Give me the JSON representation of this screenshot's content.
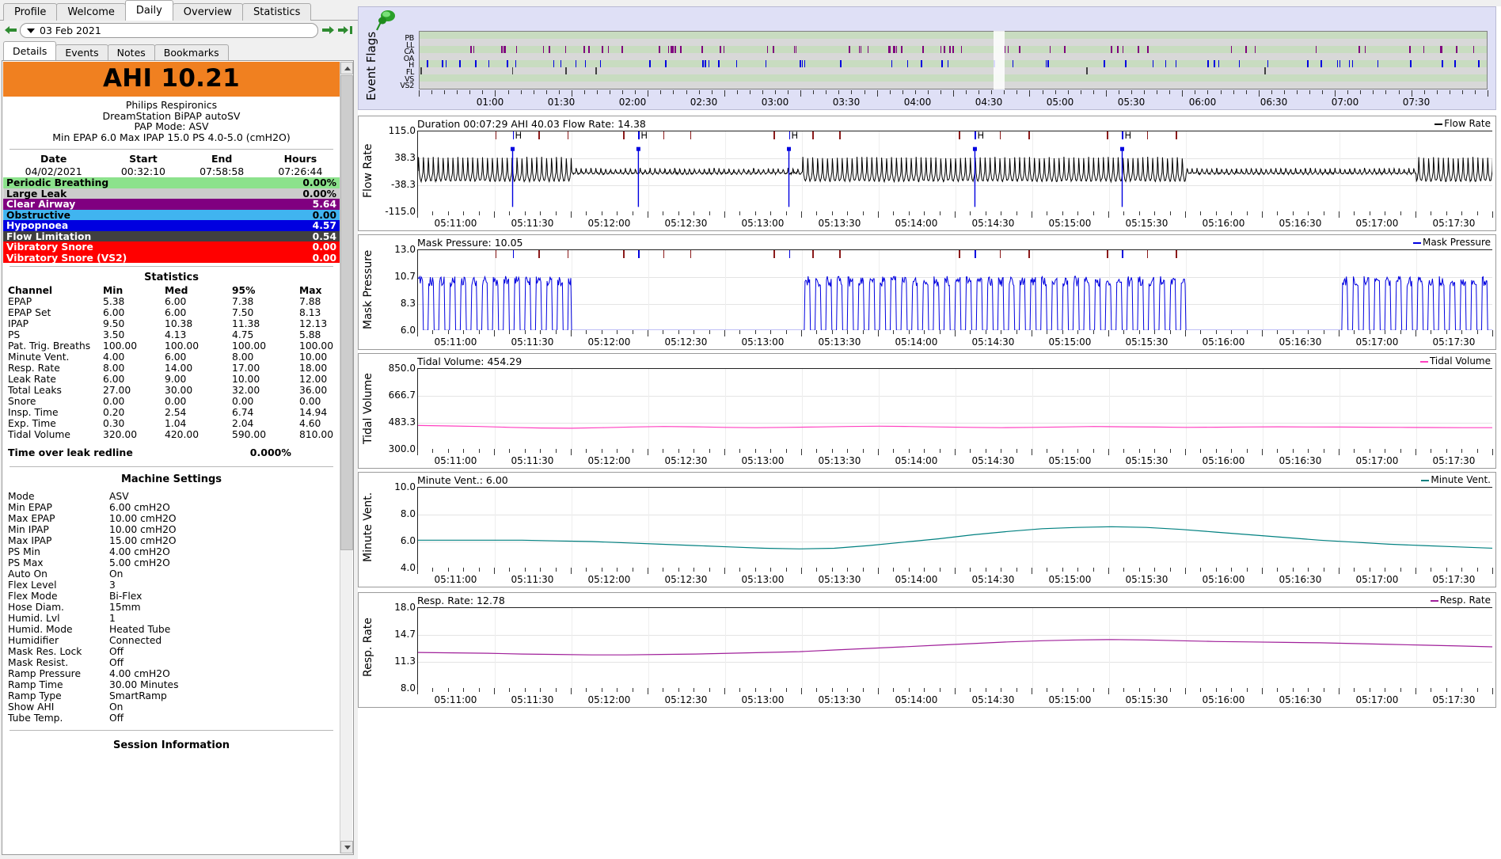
{
  "window": {
    "main_tabs": [
      {
        "label": "Profile",
        "active": false
      },
      {
        "label": "Welcome",
        "active": false
      },
      {
        "label": "Daily",
        "active": true
      },
      {
        "label": "Overview",
        "active": false
      },
      {
        "label": "Statistics",
        "active": false
      }
    ],
    "date_selector": {
      "value": "03 Feb 2021"
    },
    "sub_tabs": [
      {
        "label": "Details",
        "active": true
      },
      {
        "label": "Events",
        "active": false
      },
      {
        "label": "Notes",
        "active": false
      },
      {
        "label": "Bookmarks",
        "active": false
      }
    ]
  },
  "details": {
    "ahi_banner": "AHI 10.21",
    "ahi_banner_color": "#f08020",
    "manufacturer": "Philips Respironics",
    "model": "DreamStation BiPAP autoSV",
    "pap_mode": "PAP Mode: ASV",
    "pressure_summary": "Min EPAP 6.0 Max IPAP 15.0 PS 4.0-5.0 (cmH2O)",
    "session_headers": [
      "Date",
      "Start",
      "End",
      "Hours"
    ],
    "session_values": [
      "04/02/2021",
      "00:32:10",
      "07:58:58",
      "07:26:44"
    ],
    "event_rows": [
      {
        "label": "Periodic Breathing",
        "value": "0.00%",
        "bg": "#8ce28c",
        "fg": "#000000"
      },
      {
        "label": "Large Leak",
        "value": "0.00%",
        "bg": "#cccccc",
        "fg": "#000000"
      },
      {
        "label": "Clear Airway",
        "value": "5.64",
        "bg": "#800080",
        "fg": "#ffffff"
      },
      {
        "label": "Obstructive",
        "value": "0.00",
        "bg": "#40b4f0",
        "fg": "#000000"
      },
      {
        "label": "Hypopnoea",
        "value": "4.57",
        "bg": "#0000e0",
        "fg": "#ffffff"
      },
      {
        "label": "Flow Limitation",
        "value": "0.54",
        "bg": "#404040",
        "fg": "#ffffff"
      },
      {
        "label": "Vibratory Snore",
        "value": "0.00",
        "bg": "#ff0000",
        "fg": "#ffffff"
      },
      {
        "label": "Vibratory Snore (VS2)",
        "value": "0.00",
        "bg": "#ff0000",
        "fg": "#ffffff"
      }
    ],
    "statistics_title": "Statistics",
    "statistics_headers": [
      "Channel",
      "Min",
      "Med",
      "95%",
      "Max"
    ],
    "statistics_rows": [
      [
        "EPAP",
        "5.38",
        "6.00",
        "7.38",
        "7.88"
      ],
      [
        "EPAP Set",
        "6.00",
        "6.00",
        "7.50",
        "8.13"
      ],
      [
        "IPAP",
        "9.50",
        "10.38",
        "11.38",
        "12.13"
      ],
      [
        "PS",
        "3.50",
        "4.13",
        "4.75",
        "5.88"
      ],
      [
        "Pat. Trig. Breaths",
        "100.00",
        "100.00",
        "100.00",
        "100.00"
      ],
      [
        "Minute Vent.",
        "4.00",
        "6.00",
        "8.00",
        "10.00"
      ],
      [
        "Resp. Rate",
        "8.00",
        "14.00",
        "17.00",
        "18.00"
      ],
      [
        "Leak Rate",
        "6.00",
        "9.00",
        "10.00",
        "12.00"
      ],
      [
        "Total Leaks",
        "27.00",
        "30.00",
        "32.00",
        "36.00"
      ],
      [
        "Snore",
        "0.00",
        "0.00",
        "0.00",
        "0.00"
      ],
      [
        "Insp. Time",
        "0.20",
        "2.54",
        "6.74",
        "14.94"
      ],
      [
        "Exp. Time",
        "0.30",
        "1.04",
        "2.04",
        "4.60"
      ],
      [
        "Tidal Volume",
        "320.00",
        "420.00",
        "590.00",
        "810.00"
      ]
    ],
    "leak_redline_label": "Time over leak redline",
    "leak_redline_value": "0.000%",
    "machine_settings_title": "Machine Settings",
    "machine_settings": [
      [
        "Mode",
        "ASV"
      ],
      [
        "Min EPAP",
        "6.00 cmH2O"
      ],
      [
        "Max EPAP",
        "10.00 cmH2O"
      ],
      [
        "Min IPAP",
        "10.00 cmH2O"
      ],
      [
        "Max IPAP",
        "15.00 cmH2O"
      ],
      [
        "PS Min",
        "4.00 cmH2O"
      ],
      [
        "PS Max",
        "5.00 cmH2O"
      ],
      [
        "Auto On",
        "On"
      ],
      [
        "Flex Level",
        "3"
      ],
      [
        "Flex Mode",
        "Bi-Flex"
      ],
      [
        "Hose Diam.",
        "15mm"
      ],
      [
        "Humid. Lvl",
        "1"
      ],
      [
        "Humid. Mode",
        "Heated Tube"
      ],
      [
        "Humidifier",
        "Connected"
      ],
      [
        "Mask Res. Lock",
        "Off"
      ],
      [
        "Mask Resist.",
        "Off"
      ],
      [
        "Ramp Pressure",
        "4.00 cmH2O"
      ],
      [
        "Ramp Time",
        "30.00 Minutes"
      ],
      [
        "Ramp Type",
        "SmartRamp"
      ],
      [
        "Show AHI",
        "On"
      ],
      [
        "Tube Temp.",
        "Off"
      ]
    ],
    "session_information_title": "Session Information"
  },
  "event_flags": {
    "title": "Event Flags",
    "row_labels": [
      "PB",
      "LL",
      "CA",
      "OA",
      "H",
      "FL",
      "VS",
      "VS2"
    ],
    "x_ticks": [
      "01:00",
      "01:30",
      "02:00",
      "02:30",
      "03:00",
      "03:30",
      "04:00",
      "04:30",
      "05:00",
      "05:30",
      "06:00",
      "06:30",
      "07:00",
      "07:30"
    ],
    "colors": {
      "CA": "#800080",
      "OA": "#40b4f0",
      "H": "#0000e0",
      "FL": "#404040",
      "VS": "#ff0000"
    }
  },
  "chart_data": [
    {
      "type": "line",
      "name": "flow-rate",
      "title": "Duration 00:07:29 AHI 40.03 Flow Rate: 14.38",
      "legend": "Flow Rate",
      "legend_color": "#000000",
      "ylabel": "Flow Rate",
      "yticks": [
        "115.0",
        "38.3",
        "-38.3",
        "-115.0"
      ],
      "ylim": [
        -115.0,
        115.0
      ],
      "xlabel": "",
      "xticks": [
        "05:11:00",
        "05:11:30",
        "05:12:00",
        "05:12:30",
        "05:13:00",
        "05:13:30",
        "05:14:00",
        "05:14:30",
        "05:15:00",
        "05:15:30",
        "05:16:00",
        "05:16:30",
        "05:17:00",
        "05:17:30"
      ],
      "event_markers": [
        "H",
        "H",
        "H",
        "H",
        "H"
      ],
      "grid": true
    },
    {
      "type": "line",
      "name": "mask-pressure",
      "title": "Mask Pressure: 10.05",
      "legend": "Mask Pressure",
      "legend_color": "#0000e0",
      "ylabel": "Mask Pressure",
      "yticks": [
        "13.0",
        "10.7",
        "8.3",
        "6.0"
      ],
      "ylim": [
        6.0,
        13.0
      ],
      "xticks": [
        "05:11:00",
        "05:11:30",
        "05:12:00",
        "05:12:30",
        "05:13:00",
        "05:13:30",
        "05:14:00",
        "05:14:30",
        "05:15:00",
        "05:15:30",
        "05:16:00",
        "05:16:30",
        "05:17:00",
        "05:17:30"
      ],
      "grid": true
    },
    {
      "type": "line",
      "name": "tidal-volume",
      "title": "Tidal Volume: 454.29",
      "legend": "Tidal Volume",
      "legend_color": "#ff40c0",
      "ylabel": "Tidal Volume",
      "yticks": [
        "850.0",
        "666.7",
        "483.3",
        "300.0"
      ],
      "ylim": [
        300.0,
        850.0
      ],
      "xticks": [
        "05:11:00",
        "05:11:30",
        "05:12:00",
        "05:12:30",
        "05:13:00",
        "05:13:30",
        "05:14:00",
        "05:14:30",
        "05:15:00",
        "05:15:30",
        "05:16:00",
        "05:16:30",
        "05:17:00",
        "05:17:30"
      ],
      "values": [
        465,
        462,
        458,
        452,
        448,
        446,
        450,
        455,
        458,
        456,
        452,
        450,
        452,
        455,
        458,
        460,
        458,
        455,
        452,
        450,
        452,
        455,
        458,
        456,
        454,
        452,
        453,
        455,
        456,
        455,
        454,
        453,
        452,
        451,
        450,
        450
      ],
      "grid": true
    },
    {
      "type": "line",
      "name": "minute-vent",
      "title": "Minute Vent.: 6.00",
      "legend": "Minute Vent.",
      "legend_color": "#008080",
      "ylabel": "Minute Vent.",
      "yticks": [
        "10.0",
        "8.0",
        "6.0",
        "4.0"
      ],
      "ylim": [
        4.0,
        10.0
      ],
      "xticks": [
        "05:11:00",
        "05:11:30",
        "05:12:00",
        "05:12:30",
        "05:13:00",
        "05:13:30",
        "05:14:00",
        "05:14:30",
        "05:15:00",
        "05:15:30",
        "05:16:00",
        "05:16:30",
        "05:17:00",
        "05:17:30"
      ],
      "values": [
        6.1,
        6.1,
        6.1,
        6.1,
        6.05,
        6.0,
        5.9,
        5.8,
        5.7,
        5.6,
        5.5,
        5.45,
        5.5,
        5.7,
        5.95,
        6.2,
        6.5,
        6.75,
        6.95,
        7.05,
        7.1,
        7.05,
        6.9,
        6.7,
        6.5,
        6.3,
        6.1,
        5.95,
        5.8,
        5.7,
        5.6,
        5.5
      ],
      "grid": true
    },
    {
      "type": "line",
      "name": "resp-rate",
      "title": "Resp. Rate: 12.78",
      "legend": "Resp. Rate",
      "legend_color": "#a0209a",
      "ylabel": "Resp. Rate",
      "yticks": [
        "18.0",
        "14.7",
        "11.3",
        "8.0"
      ],
      "ylim": [
        8.0,
        18.0
      ],
      "xticks": [
        "05:11:00",
        "05:11:30",
        "05:12:00",
        "05:12:30",
        "05:13:00",
        "05:13:30",
        "05:14:00",
        "05:14:30",
        "05:15:00",
        "05:15:30",
        "05:16:00",
        "05:16:30",
        "05:17:00",
        "05:17:30"
      ],
      "values": [
        12.5,
        12.45,
        12.4,
        12.3,
        12.25,
        12.2,
        12.2,
        12.25,
        12.3,
        12.4,
        12.5,
        12.6,
        12.8,
        13.0,
        13.2,
        13.4,
        13.6,
        13.8,
        13.95,
        14.05,
        14.1,
        14.05,
        13.95,
        13.85,
        13.8,
        13.75,
        13.7,
        13.6,
        13.5,
        13.4,
        13.3,
        13.2
      ],
      "grid": true
    }
  ]
}
